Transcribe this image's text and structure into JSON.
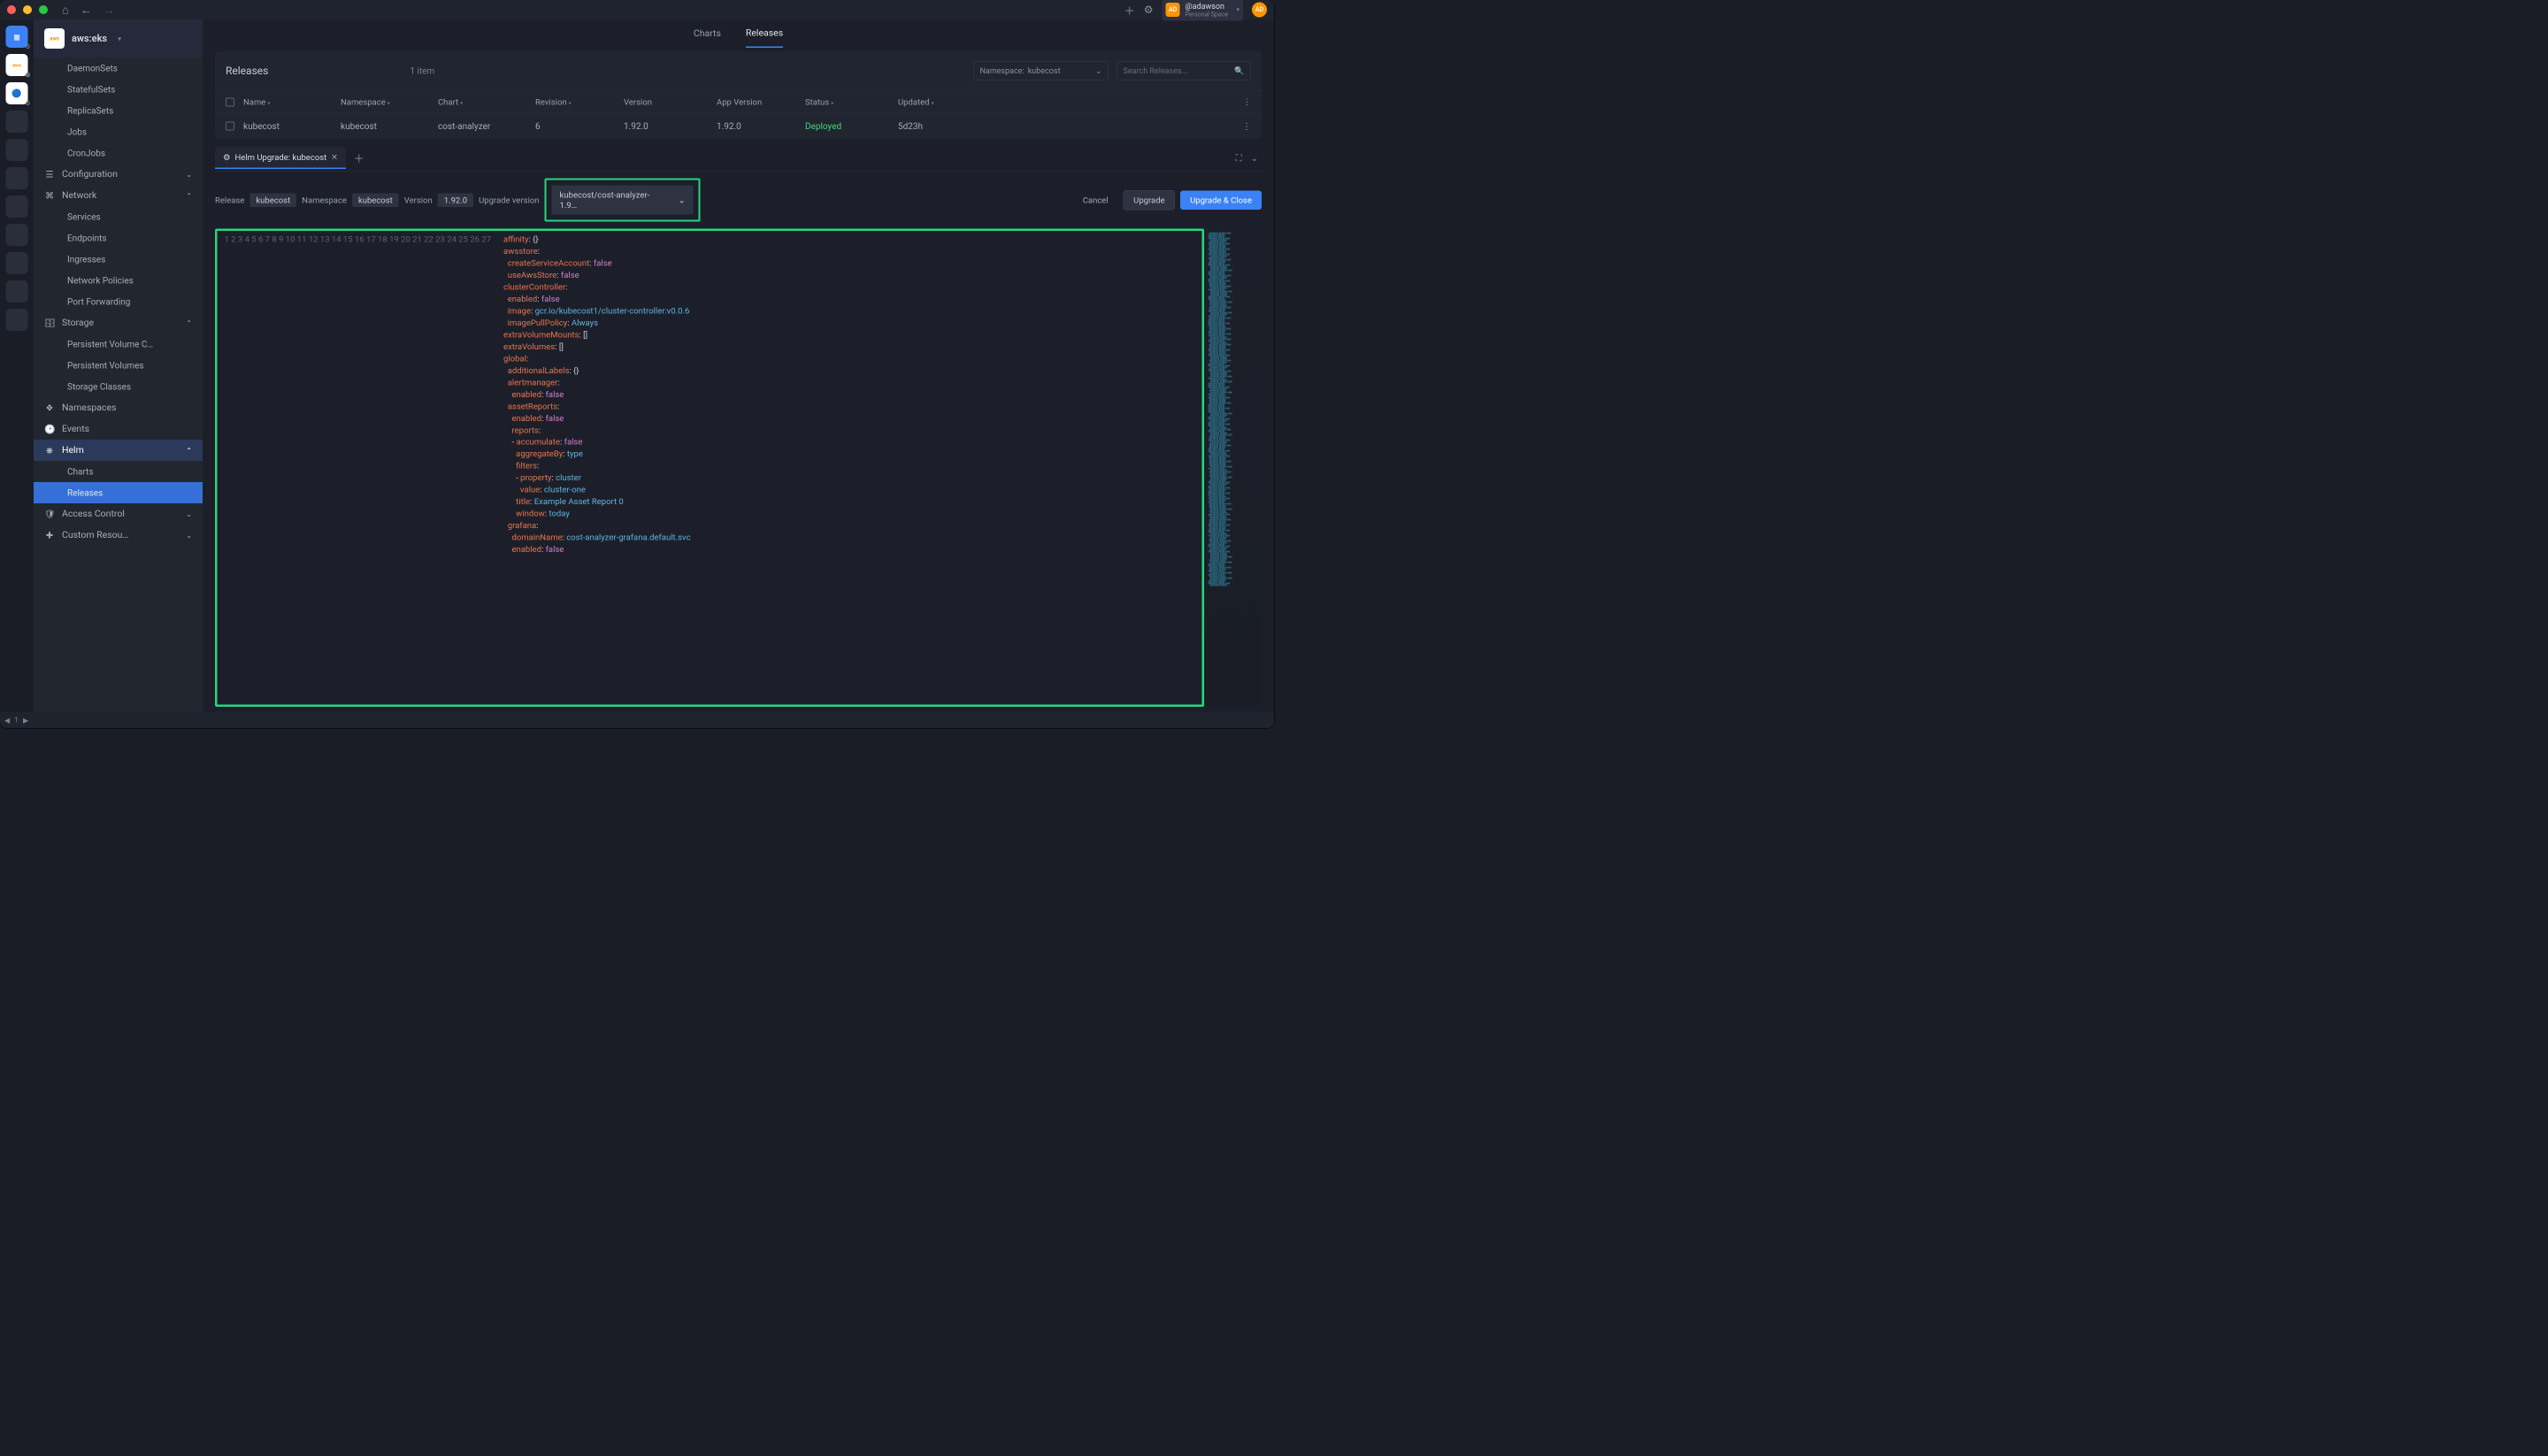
{
  "titlebar": {
    "user_handle": "@adawson",
    "user_space": "Personal Space",
    "avatar_initials": "AD"
  },
  "rail": {
    "items": [
      "grid",
      "aws",
      "gcp"
    ]
  },
  "cluster": {
    "name": "aws:eks",
    "logo": "aws"
  },
  "sidebar": {
    "workloads_children": [
      "DaemonSets",
      "StatefulSets",
      "ReplicaSets",
      "Jobs",
      "CronJobs"
    ],
    "groups": {
      "config": "Configuration",
      "network": "Network",
      "network_children": [
        "Services",
        "Endpoints",
        "Ingresses",
        "Network Policies",
        "Port Forwarding"
      ],
      "storage": "Storage",
      "storage_children": [
        "Persistent Volume C…",
        "Persistent Volumes",
        "Storage Classes"
      ],
      "namespaces": "Namespaces",
      "events": "Events",
      "helm": "Helm",
      "helm_children": [
        "Charts",
        "Releases"
      ],
      "access": "Access Control",
      "crd": "Custom Resou…"
    }
  },
  "tabs_top": {
    "charts": "Charts",
    "releases": "Releases"
  },
  "releases": {
    "title": "Releases",
    "count": "1 item",
    "ns_filter_label": "Namespace: ",
    "ns_filter_value": "kubecost",
    "search_placeholder": "Search Releases...",
    "columns": [
      "Name",
      "Namespace",
      "Chart",
      "Revision",
      "Version",
      "App Version",
      "Status",
      "Updated"
    ],
    "row": {
      "name": "kubecost",
      "namespace": "kubecost",
      "chart": "cost-analyzer",
      "revision": "6",
      "version": "1.92.0",
      "app_version": "1.92.0",
      "status": "Deployed",
      "updated": "5d23h"
    }
  },
  "subtab": {
    "icon": "⚙",
    "title": "Helm Upgrade: kubecost"
  },
  "action": {
    "release_label": "Release",
    "release_val": "kubecost",
    "ns_label": "Namespace",
    "ns_val": "kubecost",
    "ver_label": "Version",
    "ver_val": "1.92.0",
    "upgrade_ver_label": "Upgrade version",
    "upgrade_ver_select": "kubecost/cost-analyzer-1.9…",
    "cancel": "Cancel",
    "upgrade": "Upgrade",
    "upgrade_close": "Upgrade & Close"
  },
  "editor": {
    "line_count": 27
  },
  "status_bar": {
    "page": "1"
  }
}
